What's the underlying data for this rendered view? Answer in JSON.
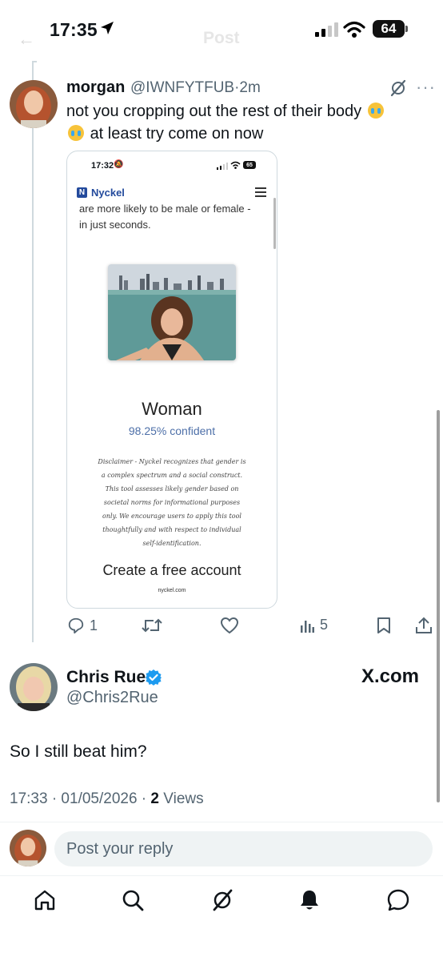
{
  "status_bar": {
    "time": "17:35",
    "battery": "64"
  },
  "quoted_tweet": {
    "name": "morgan",
    "handle_time": "@IWNFYTFUB·2m",
    "text_line1": "not you cropping out the rest of their body",
    "text_line2": "at least try come on now"
  },
  "embedded_screenshot": {
    "time": "17:32",
    "battery": "65",
    "logo_letter": "N",
    "brand": "Nyckel",
    "intro_line1": "are more likely to be male or female -",
    "intro_line2": "in just seconds.",
    "result": "Woman",
    "confidence": "98.25% confident",
    "disclaimer": "Disclaimer - Nyckel recognizes that gender is a complex spectrum and a social construct. This tool assesses likely gender based on societal norms for informational purposes only. We encourage users to apply this tool thoughtfully and with respect to individual self-identification.",
    "cta": "Create a free account",
    "footer": "nyckel.com"
  },
  "actions": {
    "replies": "1",
    "views": "5"
  },
  "main_tweet": {
    "name": "Chris Rue",
    "handle": "@Chris2Rue",
    "watermark": "X.com",
    "text": "So I still beat him?",
    "timestamp": "17:33 · 01/05/2026 · ",
    "views_count": "2",
    "views_label": " Views"
  },
  "reply": {
    "placeholder": "Post your reply"
  },
  "colors": {
    "accent": "#1d9bf0",
    "text": "#0f1419",
    "secondary": "#536471"
  },
  "icons": [
    "location-arrow-icon",
    "signal-icon",
    "wifi-icon",
    "battery-icon",
    "grok-icon",
    "more-icon",
    "reply-icon",
    "retweet-icon",
    "like-icon",
    "views-icon",
    "bookmark-icon",
    "share-icon",
    "verified-badge-icon",
    "home-icon",
    "search-icon",
    "grok-tab-icon",
    "notifications-icon",
    "messages-icon"
  ]
}
